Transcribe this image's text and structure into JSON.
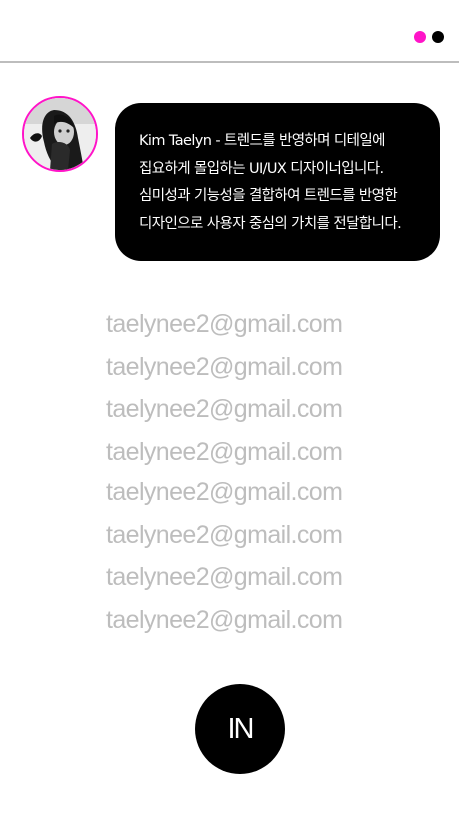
{
  "colors": {
    "accent": "#ff14c8",
    "dark": "#000000",
    "muted": "#bdbdbd"
  },
  "header": {
    "indicators": [
      "pink-dot",
      "black-dot"
    ]
  },
  "profile": {
    "avatar_icon": "profile-photo",
    "bio_lines": [
      "Kim Taelyn - 트렌드를 반영하며 디테일에",
      "집요하게 몰입하는 UI/UX 디자이너입니다.",
      "심미성과 기능성을 결합하여 트렌드를 반영한",
      "디자인으로 사용자 중심의 가치를 전달합니다."
    ]
  },
  "emails": [
    "taelynee2@gmail.com",
    "taelynee2@gmail.com",
    "taelynee2@gmail.com",
    "taelynee2@gmail.com",
    "taelynee2@gmail.com",
    "taelynee2@gmail.com",
    "taelynee2@gmail.com",
    "taelynee2@gmail.com"
  ],
  "cta": {
    "label": "IN"
  }
}
